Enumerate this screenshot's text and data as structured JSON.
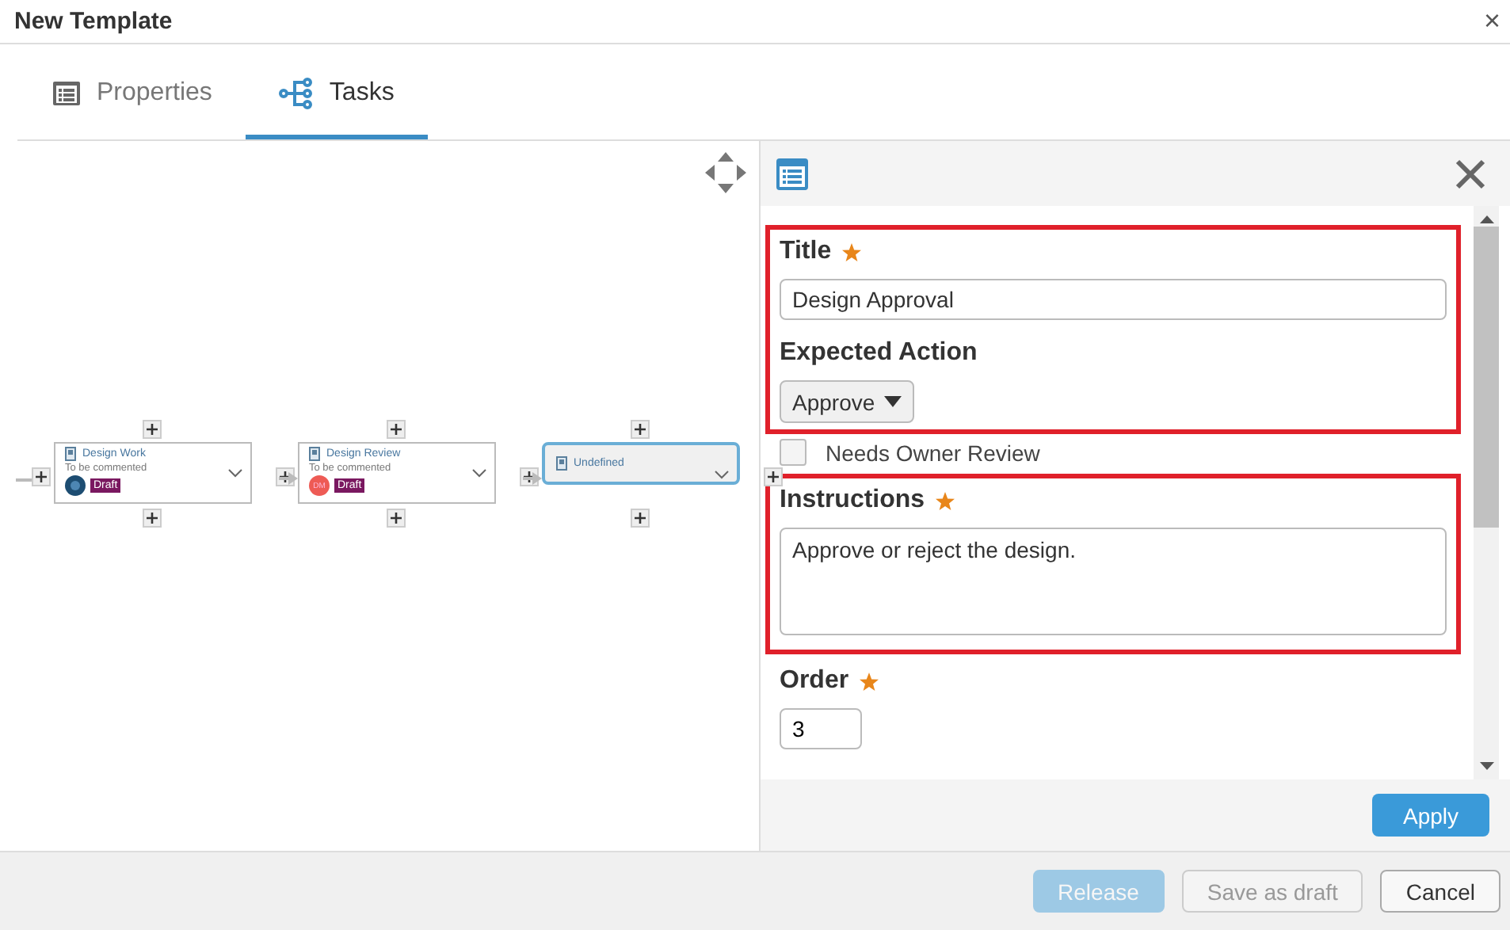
{
  "window": {
    "title": "New Template",
    "close": "×"
  },
  "tabs": [
    {
      "label": "Properties",
      "selected": false
    },
    {
      "label": "Tasks",
      "selected": true
    }
  ],
  "diagram": {
    "nodes": [
      {
        "name": "Design Work",
        "status": "To be commented",
        "avatar": {
          "kind": "image"
        },
        "badge": "Draft",
        "selected": false
      },
      {
        "name": "Design Review",
        "status": "To be commented",
        "avatar": {
          "kind": "initials",
          "initials": "DM"
        },
        "badge": "Draft",
        "selected": false
      },
      {
        "name": "Undefined",
        "selected": true
      }
    ]
  },
  "panel": {
    "groups": [
      {
        "highlighted": true,
        "fields": [
          {
            "kind": "text",
            "label": "Title",
            "required": true,
            "value": "Design Approval"
          },
          {
            "kind": "select",
            "label": "Expected Action",
            "required": false,
            "value": "Approve"
          }
        ]
      },
      {
        "highlighted": false,
        "fields": [
          {
            "kind": "checkbox",
            "label": "Needs Owner Review",
            "checked": false
          }
        ]
      },
      {
        "highlighted": true,
        "fields": [
          {
            "kind": "textarea",
            "label": "Instructions",
            "required": true,
            "value": "Approve or reject the design."
          }
        ]
      },
      {
        "highlighted": false,
        "fields": [
          {
            "kind": "number",
            "label": "Order",
            "required": true,
            "value": "3"
          }
        ]
      }
    ],
    "apply": "Apply"
  },
  "footer": [
    {
      "label": "Release",
      "kind": "primary",
      "disabled": true
    },
    {
      "label": "Save as draft",
      "kind": "default",
      "disabled": true
    },
    {
      "label": "Cancel",
      "kind": "default",
      "disabled": false
    }
  ]
}
